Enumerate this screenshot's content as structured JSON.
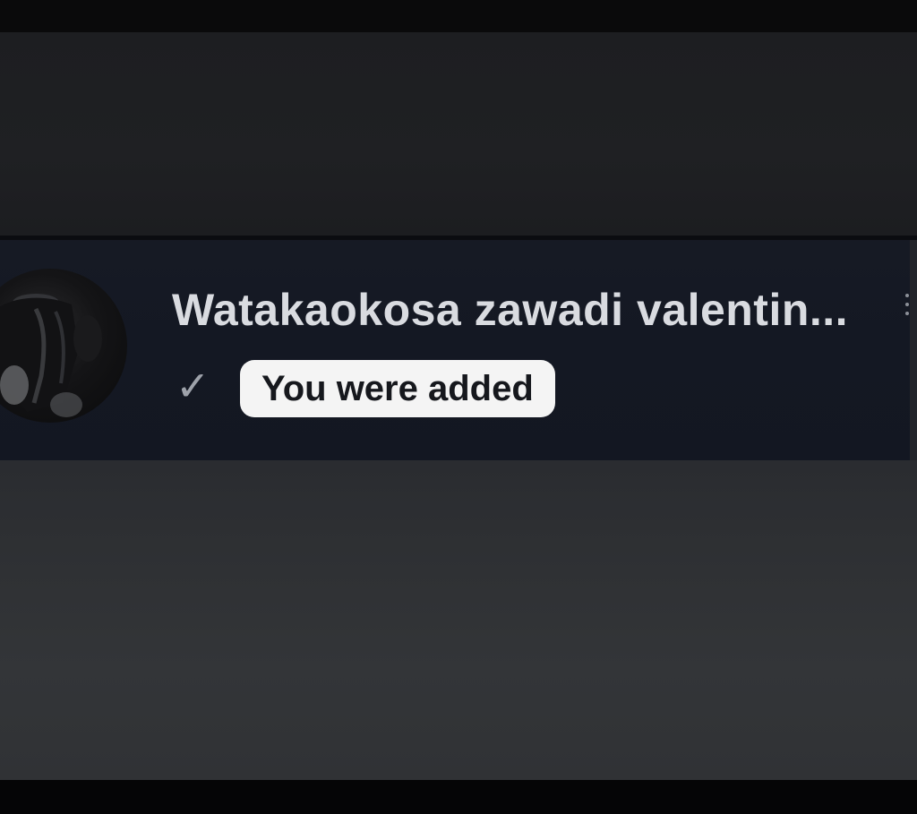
{
  "chat_list": {
    "item": {
      "title": "Watakaokosa zawadi valentin...",
      "status_label": "You were added",
      "check_glyph": "✓",
      "avatar_icon": "group-avatar-icon",
      "menu_icon": "more-vertical-icon"
    }
  },
  "colors": {
    "row_background": "#141823",
    "title_text": "#d9dbe0",
    "pill_background": "#f4f4f4",
    "pill_text": "#16181d",
    "check": "#9ea2aa"
  }
}
